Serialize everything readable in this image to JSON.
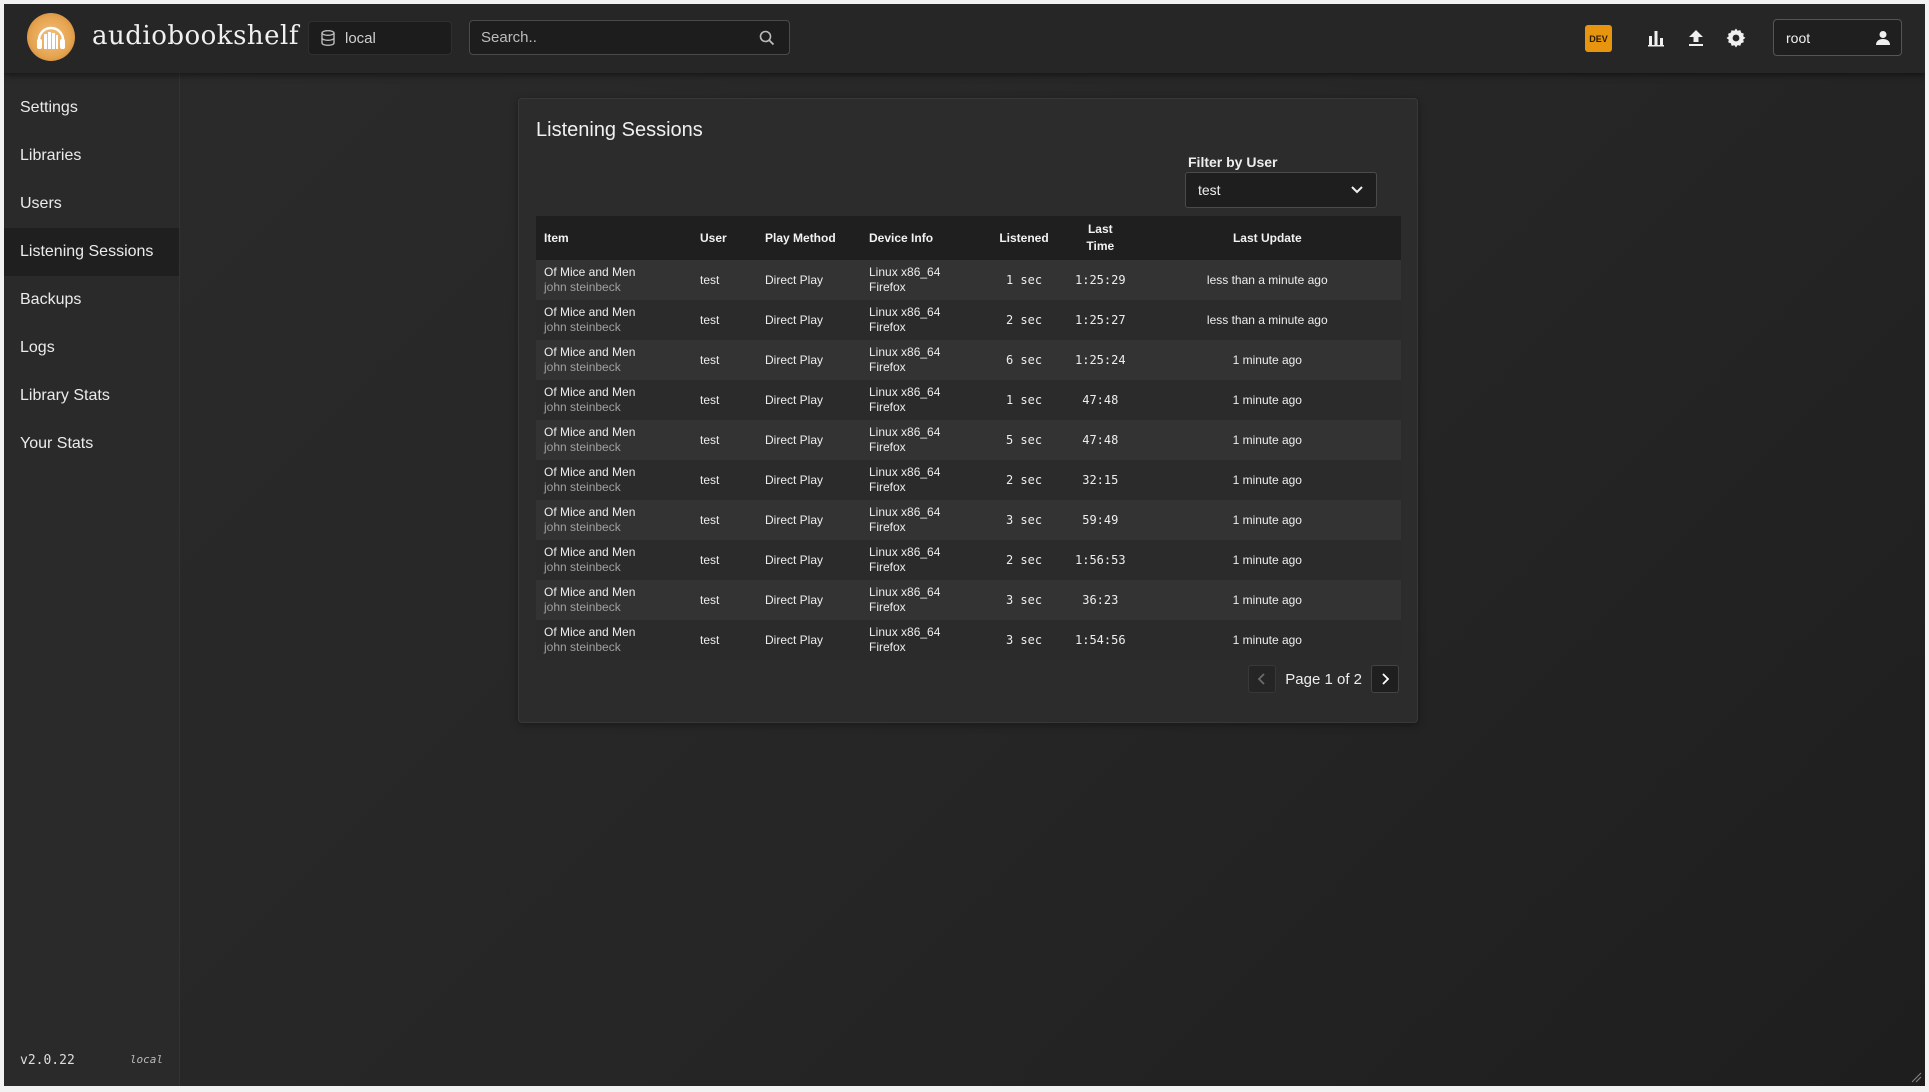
{
  "header": {
    "app_title": "audiobookshelf",
    "library": "local",
    "search_placeholder": "Search..",
    "dev_badge": "DEV",
    "username": "root",
    "icons": [
      "stats-icon",
      "upload-icon",
      "settings-gear-icon",
      "user-icon"
    ]
  },
  "sidebar": {
    "items": [
      {
        "label": "Settings"
      },
      {
        "label": "Libraries"
      },
      {
        "label": "Users"
      },
      {
        "label": "Listening Sessions",
        "active": true
      },
      {
        "label": "Backups"
      },
      {
        "label": "Logs"
      },
      {
        "label": "Library Stats"
      },
      {
        "label": "Your Stats"
      }
    ],
    "version": "v2.0.22",
    "env": "local"
  },
  "panel": {
    "title": "Listening Sessions",
    "filter_label": "Filter by User",
    "filter_value": "test",
    "columns": [
      "Item",
      "User",
      "Play Method",
      "Device Info",
      "Listened",
      "Last Time",
      "Last Update"
    ],
    "rows": [
      {
        "title": "Of Mice and Men",
        "author": "john steinbeck",
        "user": "test",
        "method": "Direct Play",
        "device1": "Linux x86_64",
        "device2": "Firefox",
        "listened": "1 sec",
        "last_time": "1:25:29",
        "updated": "less than a minute ago"
      },
      {
        "title": "Of Mice and Men",
        "author": "john steinbeck",
        "user": "test",
        "method": "Direct Play",
        "device1": "Linux x86_64",
        "device2": "Firefox",
        "listened": "2 sec",
        "last_time": "1:25:27",
        "updated": "less than a minute ago"
      },
      {
        "title": "Of Mice and Men",
        "author": "john steinbeck",
        "user": "test",
        "method": "Direct Play",
        "device1": "Linux x86_64",
        "device2": "Firefox",
        "listened": "6 sec",
        "last_time": "1:25:24",
        "updated": "1 minute ago"
      },
      {
        "title": "Of Mice and Men",
        "author": "john steinbeck",
        "user": "test",
        "method": "Direct Play",
        "device1": "Linux x86_64",
        "device2": "Firefox",
        "listened": "1 sec",
        "last_time": "47:48",
        "updated": "1 minute ago"
      },
      {
        "title": "Of Mice and Men",
        "author": "john steinbeck",
        "user": "test",
        "method": "Direct Play",
        "device1": "Linux x86_64",
        "device2": "Firefox",
        "listened": "5 sec",
        "last_time": "47:48",
        "updated": "1 minute ago"
      },
      {
        "title": "Of Mice and Men",
        "author": "john steinbeck",
        "user": "test",
        "method": "Direct Play",
        "device1": "Linux x86_64",
        "device2": "Firefox",
        "listened": "2 sec",
        "last_time": "32:15",
        "updated": "1 minute ago"
      },
      {
        "title": "Of Mice and Men",
        "author": "john steinbeck",
        "user": "test",
        "method": "Direct Play",
        "device1": "Linux x86_64",
        "device2": "Firefox",
        "listened": "3 sec",
        "last_time": "59:49",
        "updated": "1 minute ago"
      },
      {
        "title": "Of Mice and Men",
        "author": "john steinbeck",
        "user": "test",
        "method": "Direct Play",
        "device1": "Linux x86_64",
        "device2": "Firefox",
        "listened": "2 sec",
        "last_time": "1:56:53",
        "updated": "1 minute ago"
      },
      {
        "title": "Of Mice and Men",
        "author": "john steinbeck",
        "user": "test",
        "method": "Direct Play",
        "device1": "Linux x86_64",
        "device2": "Firefox",
        "listened": "3 sec",
        "last_time": "36:23",
        "updated": "1 minute ago"
      },
      {
        "title": "Of Mice and Men",
        "author": "john steinbeck",
        "user": "test",
        "method": "Direct Play",
        "device1": "Linux x86_64",
        "device2": "Firefox",
        "listened": "3 sec",
        "last_time": "1:54:56",
        "updated": "1 minute ago"
      }
    ],
    "pager_text": "Page 1 of 2"
  },
  "colors": {
    "dev_badge": "#e7950e",
    "logo": "#e6a34f",
    "background": "#212121"
  }
}
